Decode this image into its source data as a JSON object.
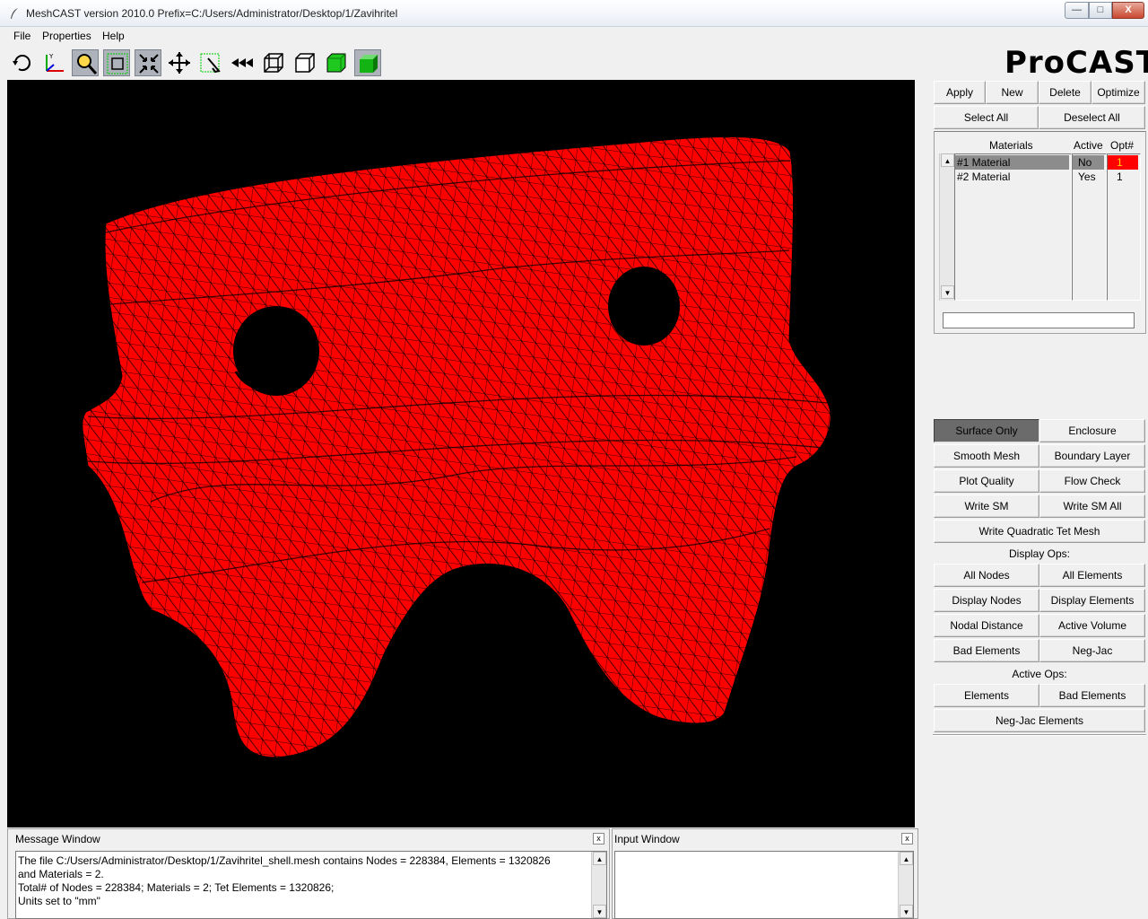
{
  "window": {
    "title": "MeshCAST version 2010.0    Prefix=C:/Users/Administrator/Desktop/1/Zavihritel",
    "min_label": "—",
    "max_label": "□",
    "close_label": "X"
  },
  "menu": {
    "items": [
      "File",
      "Properties",
      "Help"
    ]
  },
  "toolbar": {
    "icons": [
      "rotate-icon",
      "axes-icon",
      "zoom-icon",
      "zoom-box-icon",
      "fit-icon",
      "pan-icon",
      "pick-icon",
      "rewind-icon",
      "wireframe-cube-icon",
      "hidden-line-cube-icon",
      "solid-cube-icon",
      "shaded-cube-icon"
    ]
  },
  "logo": "ProCAST",
  "top_buttons": {
    "apply": "Apply",
    "new": "New",
    "delete": "Delete",
    "optimize": "Optimize",
    "select_all": "Select All",
    "deselect_all": "Deselect All"
  },
  "materials": {
    "headers": {
      "name": "Materials",
      "active": "Active",
      "opt": "Opt#"
    },
    "rows": [
      {
        "name": "#1 Material",
        "active": "No",
        "opt": "1"
      },
      {
        "name": "#2 Material",
        "active": "Yes",
        "opt": "1"
      }
    ],
    "input_value": ""
  },
  "ops": {
    "surface_only": "Surface Only",
    "enclosure": "Enclosure",
    "smooth_mesh": "Smooth Mesh",
    "boundary_layer": "Boundary Layer",
    "plot_quality": "Plot Quality",
    "flow_check": "Flow Check",
    "write_sm": "Write SM",
    "write_sm_all": "Write SM All",
    "write_quadratic": "Write Quadratic Tet Mesh",
    "display_ops": "Display Ops:",
    "all_nodes": "All Nodes",
    "all_elements": "All Elements",
    "display_nodes": "Display Nodes",
    "display_elements": "Display Elements",
    "nodal_distance": "Nodal Distance",
    "active_volume": "Active Volume",
    "bad_elements": "Bad Elements",
    "neg_jac": "Neg-Jac",
    "active_ops": "Active Ops:",
    "elements": "Elements",
    "bad_elements2": "Bad Elements",
    "neg_jac_elements": "Neg-Jac Elements"
  },
  "message_window": {
    "title": "Message Window",
    "close": "x",
    "lines": [
      "The file C:/Users/Administrator/Desktop/1/Zavihritel_shell.mesh contains Nodes = 228384, Elements = 1320826",
      "and Materials = 2.",
      "Total# of Nodes = 228384; Materials = 2; Tet Elements = 1320826;",
      "Units set to \"mm\""
    ]
  },
  "input_window": {
    "title": "Input Window",
    "close": "x",
    "value": ""
  },
  "colors": {
    "mesh_fill": "#ff0000",
    "mesh_line": "#000000",
    "viewport_bg": "#000000",
    "highlight": "#ff0000",
    "selected_row": "#8c8c8c",
    "pressed_button": "#6b6b6b"
  }
}
